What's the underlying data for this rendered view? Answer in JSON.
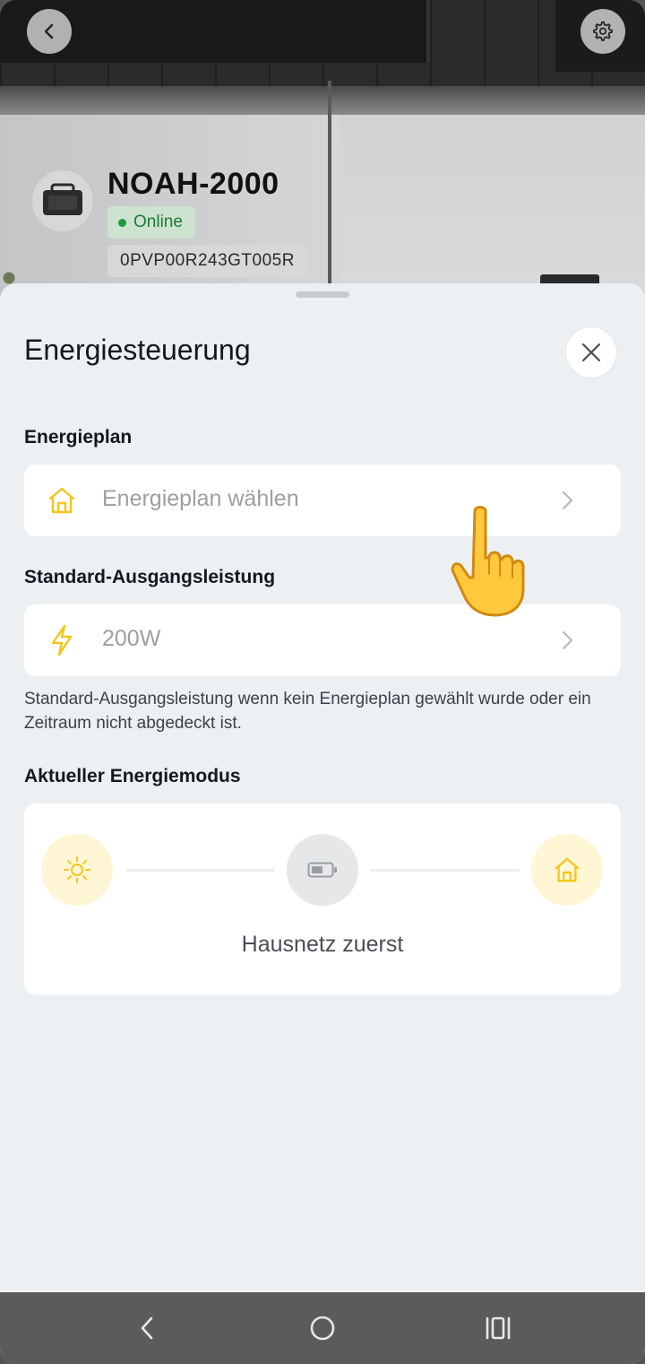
{
  "device": {
    "name": "NOAH-2000",
    "status": "Online",
    "serial": "0PVP00R243GT005R"
  },
  "header": {
    "back_icon": "chevron-left-icon",
    "settings_icon": "gear-icon"
  },
  "sheet": {
    "title": "Energiesteuerung",
    "close_icon": "close-icon",
    "energy_plan": {
      "label": "Energieplan",
      "placeholder": "Energieplan wählen",
      "icon": "home-icon"
    },
    "default_output": {
      "label": "Standard-Ausgangsleistung",
      "value": "200W",
      "icon": "lightning-icon",
      "hint": "Standard-Ausgangsleistung wenn kein Energieplan gewählt wurde oder ein Zeitraum nicht abgedeckt ist."
    },
    "current_mode": {
      "label": "Aktueller Energiemodus",
      "mode": "Hausnetz zuerst",
      "nodes": [
        "sun-icon",
        "battery-icon",
        "home-icon"
      ]
    }
  },
  "colors": {
    "accent_yellow": "#f5c518",
    "node_yellow_bg": "#fff6d6",
    "node_gray_bg": "#e6e7e8",
    "online_green": "#1e9a3c",
    "sheet_bg": "#ecf0f3"
  },
  "navbar": {
    "back_icon": "nav-back-icon",
    "home_icon": "nav-home-icon",
    "recents_icon": "nav-recents-icon"
  }
}
